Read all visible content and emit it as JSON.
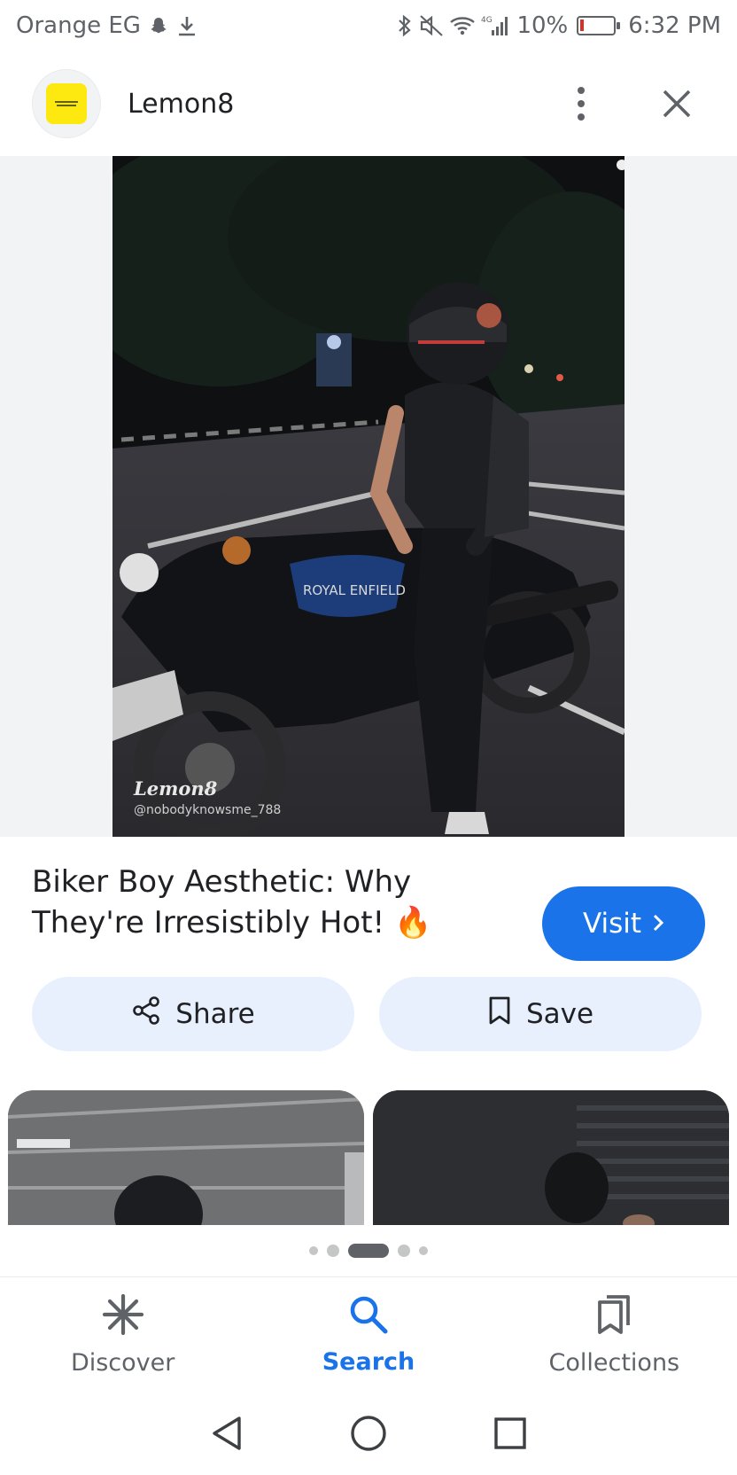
{
  "status_bar": {
    "carrier": "Orange EG",
    "network": "4G",
    "battery": "10%",
    "battery_level": 0.1,
    "time": "6:32 PM",
    "icons": [
      "snapchat-icon",
      "download-icon",
      "bluetooth-icon",
      "mute-icon",
      "wifi-icon",
      "signal-icon",
      "battery-icon"
    ]
  },
  "header": {
    "app_name": "Lemon8",
    "logo_icon": "lemon8-logo-icon",
    "more_icon": "more-vert-icon",
    "close_icon": "close-icon"
  },
  "hero": {
    "watermark_logo": "Lemon8",
    "watermark_handle": "@nobodyknowsme_788"
  },
  "post": {
    "title": "Biker Boy Aesthetic: Why They're Irresistibly Hot! 🔥",
    "visit_label": "Visit"
  },
  "actions": {
    "share_label": "Share",
    "save_label": "Save"
  },
  "carousel": {
    "page_count": 5,
    "active_index": 2
  },
  "bottom_nav": {
    "items": [
      {
        "label": "Discover",
        "icon": "discover-asterisk-icon",
        "active": false
      },
      {
        "label": "Search",
        "icon": "search-icon",
        "active": true
      },
      {
        "label": "Collections",
        "icon": "collections-bookmark-icon",
        "active": false
      }
    ]
  },
  "colors": {
    "accent": "#1a73e8",
    "chip_bg": "#e8f0fe",
    "text": "#202124",
    "muted": "#5f6368",
    "battery_low": "#d93025"
  }
}
